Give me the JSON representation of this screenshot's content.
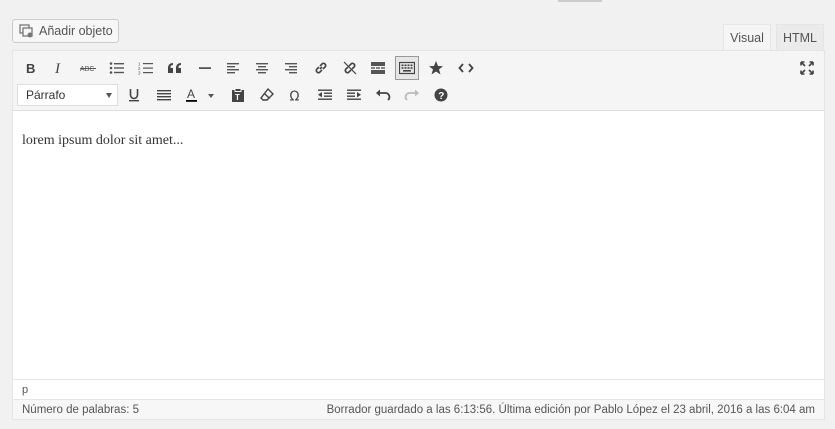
{
  "add_media": {
    "label": "Añadir objeto",
    "icon": "media-icon"
  },
  "tabs": [
    {
      "label": "Visual",
      "active": true
    },
    {
      "label": "HTML",
      "active": false
    }
  ],
  "toolbar": {
    "row1": [
      "bold-icon",
      "italic-icon",
      "strikethrough-icon",
      "bullet-list-icon",
      "numbered-list-icon",
      "blockquote-icon",
      "horizontal-rule-icon",
      "align-left-icon",
      "align-center-icon",
      "align-right-icon",
      "insert-link-icon",
      "remove-link-icon",
      "read-more-icon",
      "toolbar-toggle-icon",
      "star-icon",
      "code-icon"
    ],
    "fullscreen": "fullscreen-icon",
    "format_select": "Párrafo",
    "row2": [
      "underline-icon",
      "justify-icon",
      "text-color-icon",
      "paste-text-icon",
      "clear-formatting-icon",
      "special-character-icon",
      "outdent-icon",
      "indent-icon",
      "undo-icon",
      "redo-icon",
      "help-icon"
    ]
  },
  "content": {
    "text": "lorem ipsum dolor sit amet..."
  },
  "path": "p",
  "status": {
    "word_count": "Número de palabras: 5",
    "autosave": "Borrador guardado a las 6:13:56. Última edición por Pablo López el 23 abril, 2016 a las 6:04 am"
  },
  "colors": {
    "text_color_bar": "#000000",
    "accent_border": "#999999"
  }
}
